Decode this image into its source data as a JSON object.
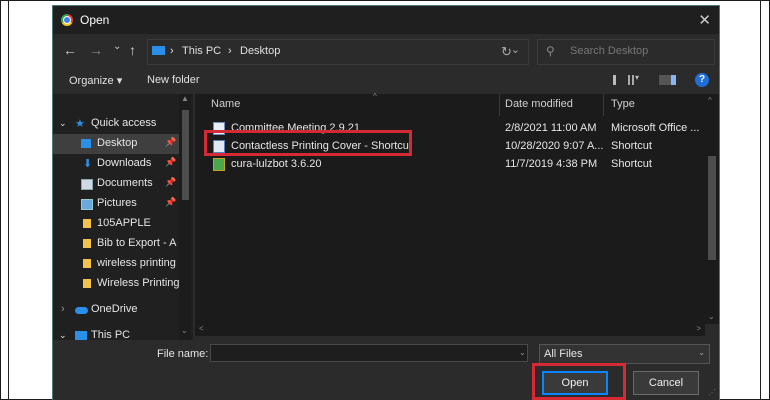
{
  "window": {
    "title": "Open",
    "close_glyph": "✕"
  },
  "nav": {
    "back": "←",
    "forward": "→",
    "recent": "⌄",
    "up": "↑",
    "breadcrumb": [
      "This PC",
      "Desktop"
    ],
    "breadcrumb_sep": "›",
    "address_chevron": "⌄",
    "refresh": "↻",
    "search_placeholder": "Search Desktop"
  },
  "toolbar": {
    "organize": "Organize ▾",
    "new_folder": "New folder",
    "view_dropdown": "▾",
    "help": "?"
  },
  "sidebar": {
    "items": [
      {
        "label": "Quick access",
        "expander": "⌄"
      },
      {
        "label": "Desktop",
        "selected": true,
        "pinned": true
      },
      {
        "label": "Downloads",
        "pinned": true
      },
      {
        "label": "Documents",
        "pinned": true
      },
      {
        "label": "Pictures",
        "pinned": true
      },
      {
        "label": "105APPLE"
      },
      {
        "label": "Bib to Export - A"
      },
      {
        "label": "wireless printing"
      },
      {
        "label": "Wireless Printing"
      },
      {
        "label": "OneDrive",
        "expander": "›"
      },
      {
        "label": "This PC",
        "expander": "⌄"
      }
    ]
  },
  "file_list": {
    "columns": [
      "Name",
      "Date modified",
      "Type"
    ],
    "rows": [
      {
        "name": "Committee Meeting 2.9.21",
        "date": "2/8/2021 11:00 AM",
        "type": "Microsoft Office ..."
      },
      {
        "name": "Contactless Printing Cover - Shortcut",
        "date": "10/28/2020 9:07 A...",
        "type": "Shortcut",
        "highlighted": true
      },
      {
        "name": "cura-lulzbot 3.6.20",
        "date": "11/7/2019 4:38 PM",
        "type": "Shortcut"
      }
    ]
  },
  "footer": {
    "file_name_label": "File name:",
    "file_name_value": "",
    "file_type": "All Files",
    "open_label": "Open",
    "cancel_label": "Cancel"
  },
  "colors": {
    "highlight": "#d42a36",
    "accent": "#0a84ff",
    "background": "#2b2b2b"
  }
}
